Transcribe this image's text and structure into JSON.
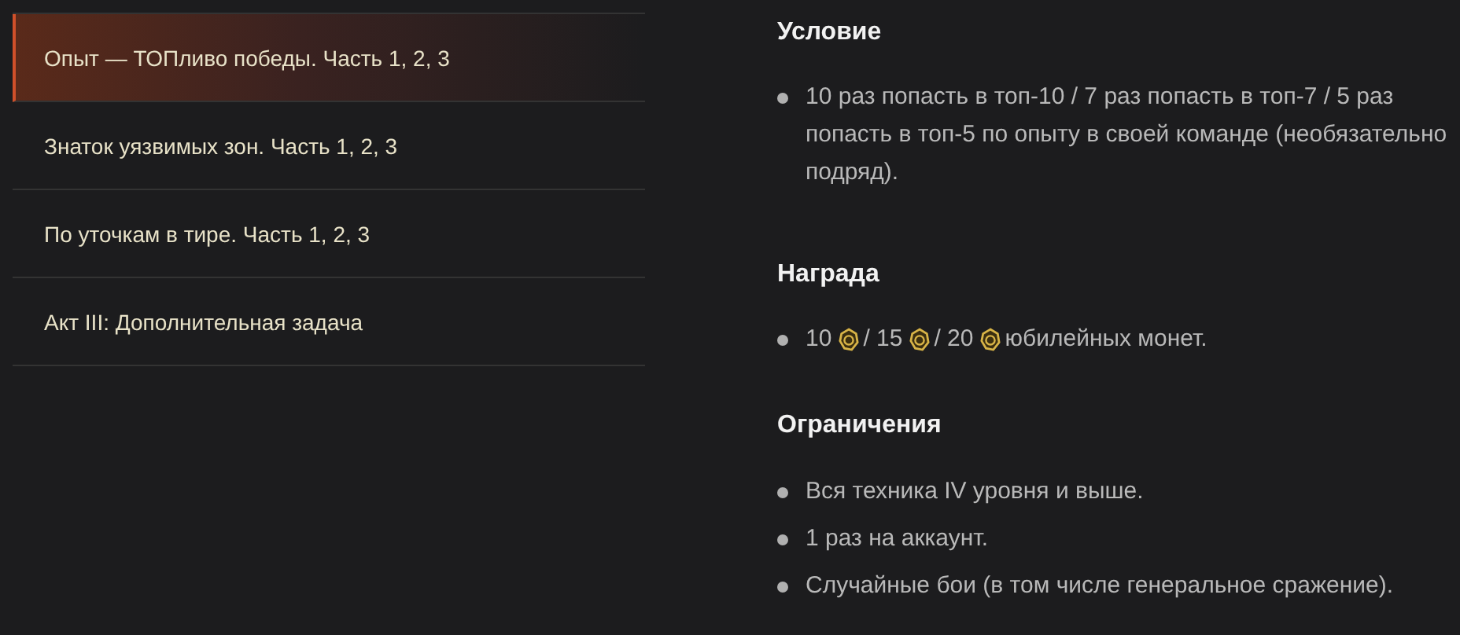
{
  "tasks": [
    {
      "label": "Опыт — ТОПливо победы. Часть 1, 2, 3",
      "selected": true
    },
    {
      "label": "Знаток уязвимых зон. Часть 1, 2, 3",
      "selected": false
    },
    {
      "label": "По уточкам в тире. Часть 1, 2, 3",
      "selected": false
    },
    {
      "label": "Акт III: Дополнительная задача",
      "selected": false
    }
  ],
  "condition": {
    "title": "Условие",
    "items": [
      "10 раз попасть в топ-10 / 7 раз попасть в топ-7 / 5 раз попасть в топ-5 по опыту в своей команде (необязательно подряд)."
    ]
  },
  "reward": {
    "title": "Награда",
    "amounts": [
      "10",
      "/ 15",
      "/ 20"
    ],
    "suffix": "юбилейных монет."
  },
  "restrictions": {
    "title": "Ограничения",
    "items": [
      "Вся техника IV уровня и выше.",
      "1 раз на аккаунт.",
      "Случайные бои (в том числе генеральное сражение)."
    ]
  }
}
